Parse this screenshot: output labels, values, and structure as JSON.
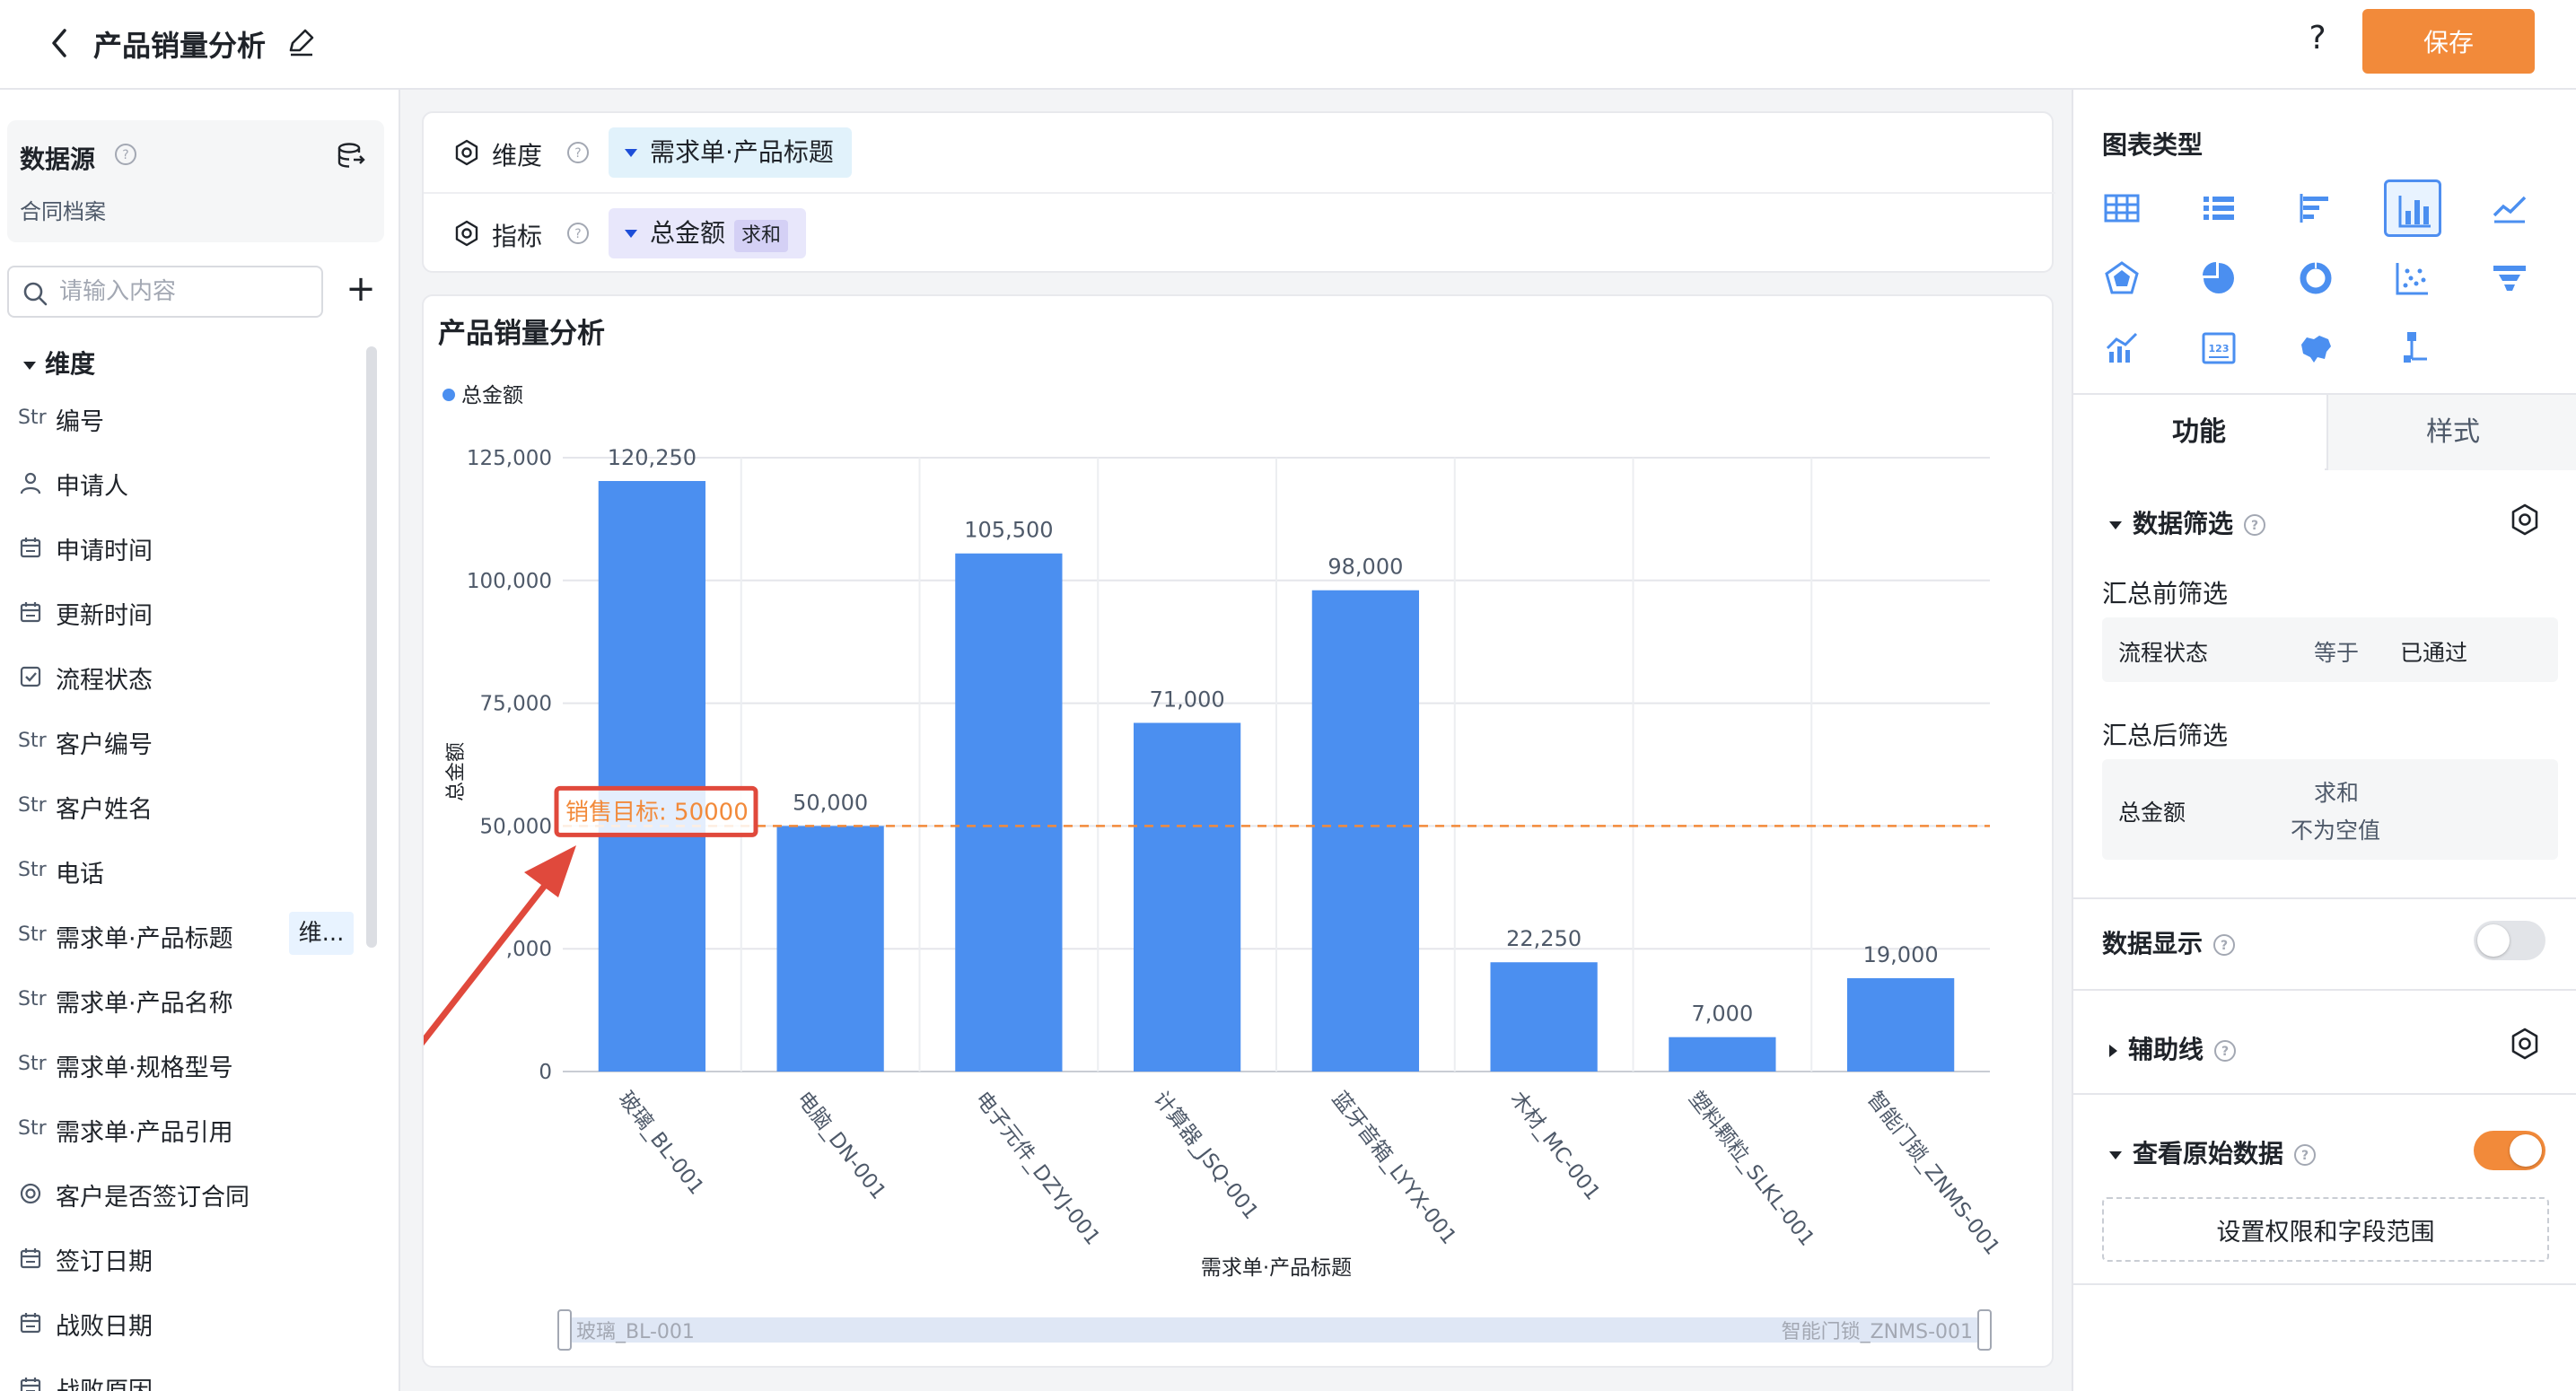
{
  "header": {
    "title": "产品销量分析",
    "help_label": "?",
    "save_label": "保存"
  },
  "datasource": {
    "title": "数据源",
    "name": "合同档案"
  },
  "search": {
    "placeholder": "请输入内容"
  },
  "dimension_section": {
    "label": "维度"
  },
  "fields": [
    {
      "type": "Str",
      "icon": "str",
      "label": "编号"
    },
    {
      "type": "user",
      "icon": "user",
      "label": "申请人"
    },
    {
      "type": "date",
      "icon": "calendar",
      "label": "申请时间"
    },
    {
      "type": "date",
      "icon": "calendar",
      "label": "更新时间"
    },
    {
      "type": "check",
      "icon": "checkbox",
      "label": "流程状态"
    },
    {
      "type": "Str",
      "icon": "str",
      "label": "客户编号"
    },
    {
      "type": "Str",
      "icon": "str",
      "label": "客户姓名"
    },
    {
      "type": "Str",
      "icon": "str",
      "label": "电话"
    },
    {
      "type": "Str",
      "icon": "str",
      "label": "需求单·产品标题",
      "tag": "维..."
    },
    {
      "type": "Str",
      "icon": "str",
      "label": "需求单·产品名称"
    },
    {
      "type": "Str",
      "icon": "str",
      "label": "需求单·规格型号"
    },
    {
      "type": "Str",
      "icon": "str",
      "label": "需求单·产品引用"
    },
    {
      "type": "radio",
      "icon": "radio",
      "label": "客户是否签订合同"
    },
    {
      "type": "date",
      "icon": "calendar",
      "label": "签订日期"
    },
    {
      "type": "date",
      "icon": "calendar",
      "label": "战败日期"
    },
    {
      "type": "date",
      "icon": "calendar",
      "label": "战败原因"
    }
  ],
  "config": {
    "dimension_label": "维度",
    "dimension_value": "需求单·产品标题",
    "metric_label": "指标",
    "metric_value": "总金额",
    "metric_agg": "求和"
  },
  "chart_title": "产品销量分析",
  "chart_data": {
    "type": "bar",
    "legend": [
      "总金额"
    ],
    "legend_position": "top-left",
    "categories": [
      "玻璃_BL-001",
      "电脑_DN-001",
      "电子元件_DZYJ-001",
      "计算器_JSQ-001",
      "蓝牙音箱_LYYX-001",
      "木材_MC-001",
      "塑料颗粒_SLKL-001",
      "智能门锁_ZNMS-001"
    ],
    "series": [
      {
        "name": "总金额",
        "values": [
          120250,
          50000,
          105500,
          71000,
          98000,
          22250,
          7000,
          19000
        ]
      }
    ],
    "data_labels": [
      "120,250",
      "50,000",
      "105,500",
      "71,000",
      "98,000",
      "22,250",
      "7,000",
      "19,000"
    ],
    "ylabel": "总金额",
    "xlabel": "需求单·产品标题",
    "ylim": [
      0,
      125000
    ],
    "yticks": [
      0,
      25000,
      50000,
      75000,
      100000,
      125000
    ],
    "ytick_labels": [
      "0",
      ",000",
      "50,000",
      "75,000",
      "100,000",
      "125,000"
    ],
    "grid": true,
    "reference_line": {
      "value": 50000,
      "label": "销售目标: 50000",
      "color": "#f28a3a"
    },
    "bar_color": "#4b8ff0",
    "zoom_start_label": "玻璃_BL-001",
    "zoom_end_label": "智能门锁_ZNMS-001"
  },
  "right_panel": {
    "chart_type_title": "图表类型",
    "chart_types": [
      {
        "icon": "table-icon"
      },
      {
        "icon": "list-icon"
      },
      {
        "icon": "bar-horizontal-icon"
      },
      {
        "icon": "bar-vertical-icon",
        "active": true
      },
      {
        "icon": "line-icon"
      },
      {
        "icon": "radar-icon"
      },
      {
        "icon": "pie-icon"
      },
      {
        "icon": "donut-icon"
      },
      {
        "icon": "scatter-icon"
      },
      {
        "icon": "funnel-icon"
      },
      {
        "icon": "combo-icon"
      },
      {
        "icon": "number-card-icon"
      },
      {
        "icon": "map-icon"
      },
      {
        "icon": "tree-icon"
      }
    ],
    "tab_function": "功能",
    "tab_style": "样式",
    "data_filter": "数据筛选",
    "pre_filter_label": "汇总前筛选",
    "pre_filter": {
      "field": "流程状态",
      "op": "等于",
      "value": "已通过"
    },
    "post_filter_label": "汇总后筛选",
    "post_filter": {
      "field": "总金额",
      "agg": "求和",
      "cond": "不为空值"
    },
    "data_display": "数据显示",
    "aux_line": "辅助线",
    "raw_data": "查看原始数据",
    "perm_button": "设置权限和字段范围"
  },
  "colors": {
    "accent": "#f28a3a",
    "bar": "#4b8ff0",
    "annotation": "#e0493c"
  }
}
